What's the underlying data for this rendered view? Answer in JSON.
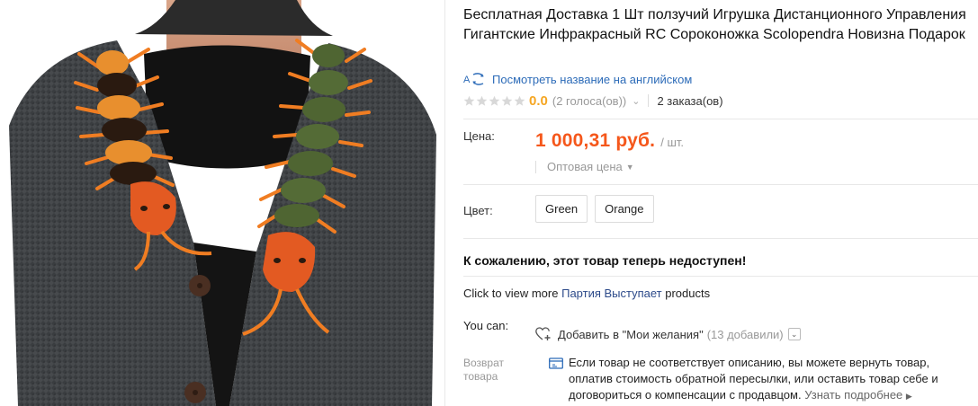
{
  "product": {
    "title": "Бесплатная Доставка 1 Шт ползучий Игрушка Дистанционного Управления Гигантские Инфракрасный RC Сороконожка Scolopendra Новизна Подарок"
  },
  "translate": {
    "link": "Посмотреть название на английском"
  },
  "rating": {
    "value": "0.0",
    "votes": "(2 голоса(ов))",
    "orders": "2 заказа(ов)"
  },
  "price": {
    "label": "Цена:",
    "value": "1 000,31 руб.",
    "unit": "/ шт.",
    "wholesale": "Оптовая цена"
  },
  "colors": {
    "label": "Цвет:",
    "options": [
      "Green",
      "Orange"
    ]
  },
  "availability": {
    "message": "К сожалению, этот товар теперь недоступен!"
  },
  "more_products": {
    "prefix": "Click to view more",
    "store": "Партия Выступает",
    "suffix": "products"
  },
  "you_can": {
    "label": "You can:",
    "wishlist": "Добавить в \"Мои желания\"",
    "wishlist_count": "(13 добавили)"
  },
  "returns": {
    "label_line1": "Возврат",
    "label_line2": "товара",
    "line1": "Если товар не соответствует описанию, вы можете вернуть товар,",
    "line2": "оплатив стоимость обратной пересылки, или оставить товар себе и",
    "line3": "договориться о компенсации с продавцом.",
    "learn_more": "Узнать подробнее"
  },
  "icons": {
    "translate": "translate-icon",
    "star": "star-icon",
    "heart": "heart-plus-icon",
    "return": "return-policy-icon"
  },
  "colors_theme": {
    "price": "#f5571b",
    "rating": "#f5a623",
    "link": "#2c6bb8"
  }
}
